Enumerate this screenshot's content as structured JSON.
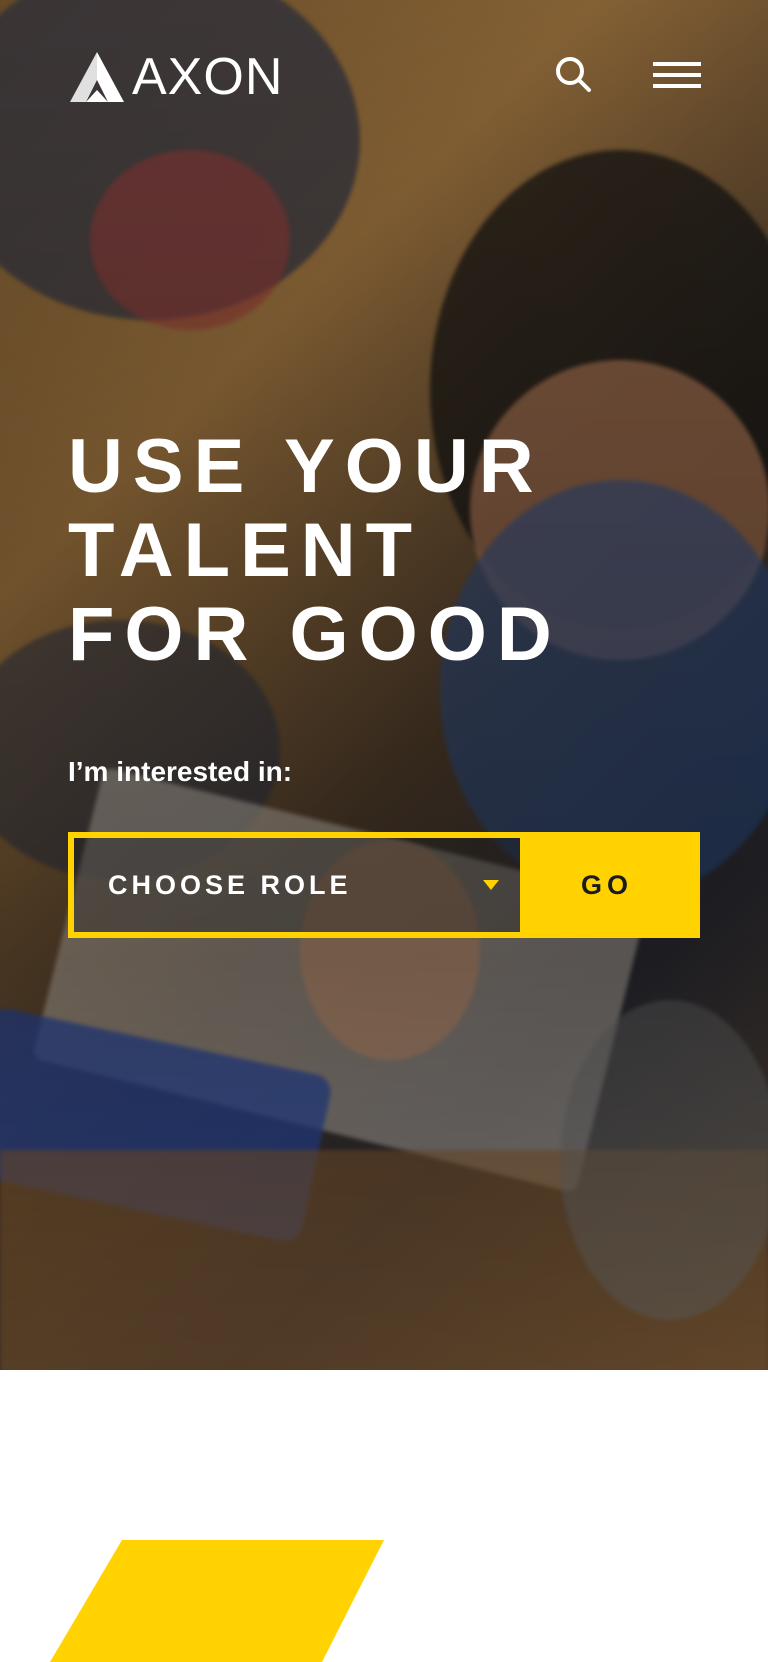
{
  "brand": {
    "name": "AXON",
    "accent_color": "#ffd200"
  },
  "header": {
    "search_icon": "search-icon",
    "menu_icon": "hamburger-menu-icon"
  },
  "hero": {
    "headline_lines": [
      "USE YOUR",
      "TALENT",
      "FOR GOOD"
    ],
    "interest_label": "I’m interested in:",
    "role_select": {
      "selected_value": "CHOOSE ROLE"
    },
    "go_label": "GO"
  }
}
